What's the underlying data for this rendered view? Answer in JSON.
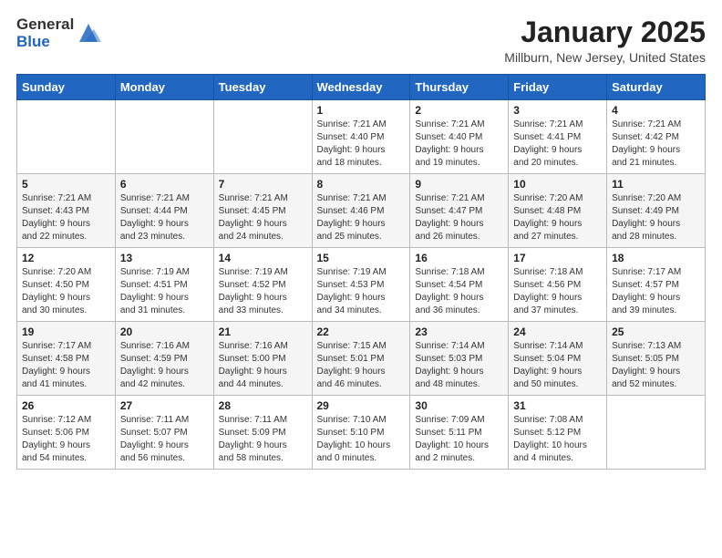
{
  "header": {
    "logo_general": "General",
    "logo_blue": "Blue",
    "month_title": "January 2025",
    "location": "Millburn, New Jersey, United States"
  },
  "columns": [
    "Sunday",
    "Monday",
    "Tuesday",
    "Wednesday",
    "Thursday",
    "Friday",
    "Saturday"
  ],
  "weeks": [
    [
      {
        "day": "",
        "info": ""
      },
      {
        "day": "",
        "info": ""
      },
      {
        "day": "",
        "info": ""
      },
      {
        "day": "1",
        "info": "Sunrise: 7:21 AM\nSunset: 4:40 PM\nDaylight: 9 hours\nand 18 minutes."
      },
      {
        "day": "2",
        "info": "Sunrise: 7:21 AM\nSunset: 4:40 PM\nDaylight: 9 hours\nand 19 minutes."
      },
      {
        "day": "3",
        "info": "Sunrise: 7:21 AM\nSunset: 4:41 PM\nDaylight: 9 hours\nand 20 minutes."
      },
      {
        "day": "4",
        "info": "Sunrise: 7:21 AM\nSunset: 4:42 PM\nDaylight: 9 hours\nand 21 minutes."
      }
    ],
    [
      {
        "day": "5",
        "info": "Sunrise: 7:21 AM\nSunset: 4:43 PM\nDaylight: 9 hours\nand 22 minutes."
      },
      {
        "day": "6",
        "info": "Sunrise: 7:21 AM\nSunset: 4:44 PM\nDaylight: 9 hours\nand 23 minutes."
      },
      {
        "day": "7",
        "info": "Sunrise: 7:21 AM\nSunset: 4:45 PM\nDaylight: 9 hours\nand 24 minutes."
      },
      {
        "day": "8",
        "info": "Sunrise: 7:21 AM\nSunset: 4:46 PM\nDaylight: 9 hours\nand 25 minutes."
      },
      {
        "day": "9",
        "info": "Sunrise: 7:21 AM\nSunset: 4:47 PM\nDaylight: 9 hours\nand 26 minutes."
      },
      {
        "day": "10",
        "info": "Sunrise: 7:20 AM\nSunset: 4:48 PM\nDaylight: 9 hours\nand 27 minutes."
      },
      {
        "day": "11",
        "info": "Sunrise: 7:20 AM\nSunset: 4:49 PM\nDaylight: 9 hours\nand 28 minutes."
      }
    ],
    [
      {
        "day": "12",
        "info": "Sunrise: 7:20 AM\nSunset: 4:50 PM\nDaylight: 9 hours\nand 30 minutes."
      },
      {
        "day": "13",
        "info": "Sunrise: 7:19 AM\nSunset: 4:51 PM\nDaylight: 9 hours\nand 31 minutes."
      },
      {
        "day": "14",
        "info": "Sunrise: 7:19 AM\nSunset: 4:52 PM\nDaylight: 9 hours\nand 33 minutes."
      },
      {
        "day": "15",
        "info": "Sunrise: 7:19 AM\nSunset: 4:53 PM\nDaylight: 9 hours\nand 34 minutes."
      },
      {
        "day": "16",
        "info": "Sunrise: 7:18 AM\nSunset: 4:54 PM\nDaylight: 9 hours\nand 36 minutes."
      },
      {
        "day": "17",
        "info": "Sunrise: 7:18 AM\nSunset: 4:56 PM\nDaylight: 9 hours\nand 37 minutes."
      },
      {
        "day": "18",
        "info": "Sunrise: 7:17 AM\nSunset: 4:57 PM\nDaylight: 9 hours\nand 39 minutes."
      }
    ],
    [
      {
        "day": "19",
        "info": "Sunrise: 7:17 AM\nSunset: 4:58 PM\nDaylight: 9 hours\nand 41 minutes."
      },
      {
        "day": "20",
        "info": "Sunrise: 7:16 AM\nSunset: 4:59 PM\nDaylight: 9 hours\nand 42 minutes."
      },
      {
        "day": "21",
        "info": "Sunrise: 7:16 AM\nSunset: 5:00 PM\nDaylight: 9 hours\nand 44 minutes."
      },
      {
        "day": "22",
        "info": "Sunrise: 7:15 AM\nSunset: 5:01 PM\nDaylight: 9 hours\nand 46 minutes."
      },
      {
        "day": "23",
        "info": "Sunrise: 7:14 AM\nSunset: 5:03 PM\nDaylight: 9 hours\nand 48 minutes."
      },
      {
        "day": "24",
        "info": "Sunrise: 7:14 AM\nSunset: 5:04 PM\nDaylight: 9 hours\nand 50 minutes."
      },
      {
        "day": "25",
        "info": "Sunrise: 7:13 AM\nSunset: 5:05 PM\nDaylight: 9 hours\nand 52 minutes."
      }
    ],
    [
      {
        "day": "26",
        "info": "Sunrise: 7:12 AM\nSunset: 5:06 PM\nDaylight: 9 hours\nand 54 minutes."
      },
      {
        "day": "27",
        "info": "Sunrise: 7:11 AM\nSunset: 5:07 PM\nDaylight: 9 hours\nand 56 minutes."
      },
      {
        "day": "28",
        "info": "Sunrise: 7:11 AM\nSunset: 5:09 PM\nDaylight: 9 hours\nand 58 minutes."
      },
      {
        "day": "29",
        "info": "Sunrise: 7:10 AM\nSunset: 5:10 PM\nDaylight: 10 hours\nand 0 minutes."
      },
      {
        "day": "30",
        "info": "Sunrise: 7:09 AM\nSunset: 5:11 PM\nDaylight: 10 hours\nand 2 minutes."
      },
      {
        "day": "31",
        "info": "Sunrise: 7:08 AM\nSunset: 5:12 PM\nDaylight: 10 hours\nand 4 minutes."
      },
      {
        "day": "",
        "info": ""
      }
    ]
  ]
}
